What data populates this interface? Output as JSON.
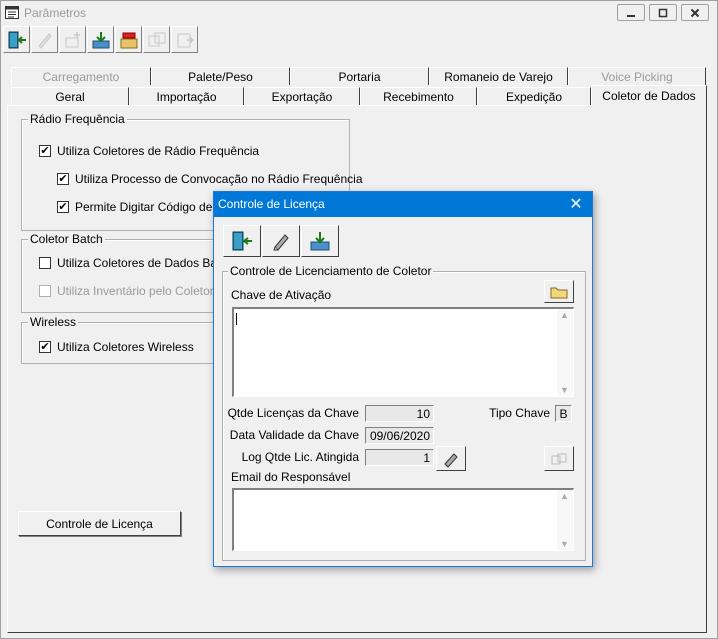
{
  "window": {
    "title": "Parâmetros"
  },
  "toolbar": {
    "buttons": [
      {
        "icon": "exit-door-icon",
        "enabled": true
      },
      {
        "icon": "pencil-icon",
        "enabled": false
      },
      {
        "icon": "add-record-icon",
        "enabled": false
      },
      {
        "icon": "save-icon",
        "enabled": true
      },
      {
        "icon": "delete-folder-icon",
        "enabled": true
      },
      {
        "icon": "copy-record-icon",
        "enabled": false
      },
      {
        "icon": "paste-record-icon",
        "enabled": false
      }
    ]
  },
  "tabs": {
    "row1": [
      "Carregamento",
      "Palete/Peso",
      "Portaria",
      "Romaneio de Varejo",
      "Voice Picking"
    ],
    "row2": [
      "Geral",
      "Importação",
      "Exportação",
      "Recebimento",
      "Expedição",
      "Coletor de Dados"
    ],
    "active": "Coletor de Dados"
  },
  "radio_freq": {
    "title": "Rádio Frequência",
    "items": [
      {
        "label": "Utiliza Coletores de Rádio Frequência",
        "checked": true,
        "enabled": true
      },
      {
        "label": "Utiliza Processo de Convocação no Rádio Frequência",
        "checked": true,
        "enabled": true
      },
      {
        "label": "Permite Digitar Código de Pro",
        "checked": true,
        "enabled": true
      }
    ]
  },
  "coletor_batch": {
    "title": "Coletor Batch",
    "items": [
      {
        "label": "Utiliza Coletores de Dados Batch",
        "checked": false,
        "enabled": true
      },
      {
        "label": "Utiliza Inventário pelo Coletor de I",
        "checked": false,
        "enabled": false
      }
    ]
  },
  "wireless": {
    "title": "Wireless",
    "items": [
      {
        "label": "Utiliza Coletores Wireless",
        "checked": true,
        "enabled": true
      }
    ]
  },
  "license_button": "Controle de Licença",
  "dialog": {
    "title": "Controle de Licença",
    "close_glyph": "✕",
    "group_title": "Controle de Licenciamento de Coletor",
    "activation_key_label": "Chave de Ativação",
    "activation_key_value": "",
    "qty_label": "Qtde Licenças da Chave",
    "qty_value": "10",
    "key_type_label": "Tipo Chave",
    "key_type_value": "B",
    "validity_label": "Data Validade da Chave",
    "validity_value": "09/06/2020",
    "log_label": "Log Qtde Lic. Atingida",
    "log_value": "1",
    "email_label": "Email do Responsável",
    "email_value": ""
  },
  "colors": {
    "dialog_title_bg": "#0078d7",
    "window_bg": "#f0f0f0",
    "disabled_text": "#9a9a9a"
  }
}
